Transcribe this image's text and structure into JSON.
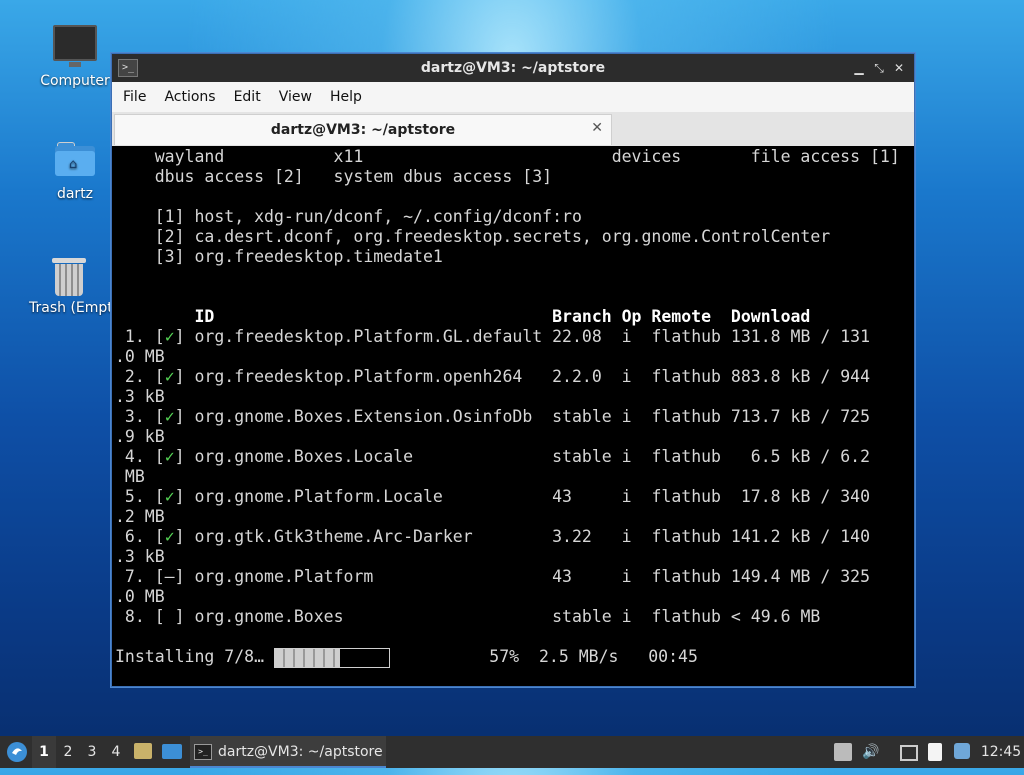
{
  "desktop": {
    "icons": [
      {
        "label": "Computer",
        "icon": "computer-icon"
      },
      {
        "label": "dartz",
        "icon": "home-folder-icon"
      },
      {
        "label": "Trash (Empty)",
        "icon": "trash-icon"
      }
    ]
  },
  "window": {
    "title": "dartz@VM3: ~/aptstore",
    "controls": {
      "minimize": "▁",
      "maximize": "⤡",
      "close": "✕"
    },
    "menu": [
      "File",
      "Actions",
      "Edit",
      "View",
      "Help"
    ],
    "tab": {
      "label": "dartz@VM3: ~/aptstore",
      "close": "✕"
    }
  },
  "terminal": {
    "permissions": [
      "wayland           x11                         devices       file access [1]",
      "dbus access [2]   system dbus access [3]"
    ],
    "footnotes": [
      "[1] host, xdg-run/dconf, ~/.config/dconf:ro",
      "[2] ca.desrt.dconf, org.freedesktop.secrets, org.gnome.ControlCenter",
      "[3] org.freedesktop.timedate1"
    ],
    "header": {
      "id": "ID",
      "branch": "Branch",
      "op": "Op",
      "remote": "Remote",
      "download": "Download"
    },
    "rows": [
      {
        "num": "1.",
        "check": "[✓]",
        "id": "org.freedesktop.Platform.GL.default",
        "branch": "22.08",
        "op": "i",
        "remote": "flathub",
        "download": "131.8 MB / 131",
        "wrap": ".0 MB"
      },
      {
        "num": "2.",
        "check": "[✓]",
        "id": "org.freedesktop.Platform.openh264",
        "branch": "2.2.0",
        "op": "i",
        "remote": "flathub",
        "download": "883.8 kB / 944",
        "wrap": ".3 kB"
      },
      {
        "num": "3.",
        "check": "[✓]",
        "id": "org.gnome.Boxes.Extension.OsinfoDb",
        "branch": "stable",
        "op": "i",
        "remote": "flathub",
        "download": "713.7 kB / 725",
        "wrap": ".9 kB"
      },
      {
        "num": "4.",
        "check": "[✓]",
        "id": "org.gnome.Boxes.Locale",
        "branch": "stable",
        "op": "i",
        "remote": "flathub",
        "download": "  6.5 kB / 6.2",
        "wrap": " MB"
      },
      {
        "num": "5.",
        "check": "[✓]",
        "id": "org.gnome.Platform.Locale",
        "branch": "43",
        "op": "i",
        "remote": "flathub",
        "download": " 17.8 kB / 340",
        "wrap": ".2 MB"
      },
      {
        "num": "6.",
        "check": "[✓]",
        "id": "org.gtk.Gtk3theme.Arc-Darker",
        "branch": "3.22",
        "op": "i",
        "remote": "flathub",
        "download": "141.2 kB / 140",
        "wrap": ".3 kB"
      },
      {
        "num": "7.",
        "check": "[—]",
        "id": "org.gnome.Platform",
        "branch": "43",
        "op": "i",
        "remote": "flathub",
        "download": "149.4 MB / 325",
        "wrap": ".0 MB"
      },
      {
        "num": "8.",
        "check": "[ ]",
        "id": "org.gnome.Boxes",
        "branch": "stable",
        "op": "i",
        "remote": "flathub",
        "download": "< 49.6 MB",
        "wrap": ""
      }
    ],
    "progress": {
      "label": "Installing 7/8…",
      "fraction": 0.57,
      "percent": "57%",
      "speed": "2.5 MB/s",
      "eta": "00:45"
    }
  },
  "taskbar": {
    "workspaces": [
      "1",
      "2",
      "3",
      "4"
    ],
    "active_workspace": "1",
    "task_label": "dartz@VM3: ~/aptstore",
    "clock": "12:45"
  },
  "colors": {
    "check": "#55d455",
    "terminal_bg": "#000000",
    "titlebar": "#2c2c2c",
    "taskbar": "#2f2f2f"
  }
}
